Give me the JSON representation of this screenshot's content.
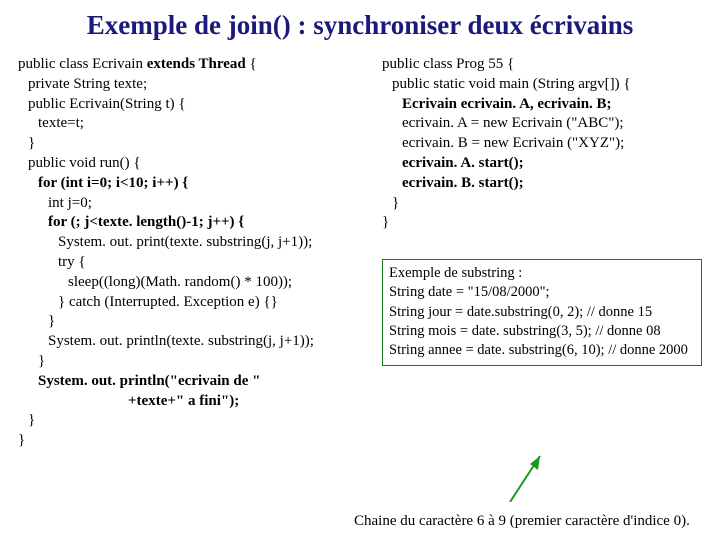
{
  "title": "Exemple de join() : synchroniser deux écrivains",
  "left": {
    "l1a": "public class Ecrivain ",
    "l1b": "extends Thread",
    "l1c": "  {",
    "l2": "private String texte;",
    "l3": "public Ecrivain(String t) {",
    "l4": "texte=t;",
    "l5": "}",
    "l6": "public void run() {",
    "l7": "for (int i=0; i<10; i++) {",
    "l8": "int j=0;",
    "l9": "for (; j<texte. length()-1; j++) {",
    "l10": "System. out. print(texte. substring(j, j+1));",
    "l11": "try {",
    "l12": "sleep((long)(Math. random() * 100));",
    "l13": "} catch (Interrupted. Exception e) {}",
    "l14": "}",
    "l15": "System. out. println(texte. substring(j, j+1));",
    "l16": "}",
    "l17": "System. out. println(\"ecrivain de \"",
    "l18": "+texte+\" a fini\");",
    "l19": "}",
    "l20": "}"
  },
  "right": {
    "r1": "public class Prog 55 {",
    "r2": "public static void main (String argv[]) {",
    "r3": "Ecrivain ecrivain. A, ecrivain. B;",
    "r4": "ecrivain. A = new Ecrivain (\"ABC\");",
    "r5": "ecrivain. B = new Ecrivain (\"XYZ\");",
    "r6": "ecrivain. A. start();",
    "r7": "ecrivain. B. start();",
    "r8": "}",
    "r9": "}"
  },
  "box": {
    "b1": "Exemple de substring :",
    "b2": "String date = \"15/08/2000\";",
    "b3": "String jour = date.substring(0, 2); // donne 15",
    "b4": "String mois = date. substring(3, 5); // donne 08",
    "b5": "String annee = date. substring(6, 10); // donne 2000"
  },
  "caption": "Chaine du caractère 6 à 9 (premier caractère d'indice 0)."
}
